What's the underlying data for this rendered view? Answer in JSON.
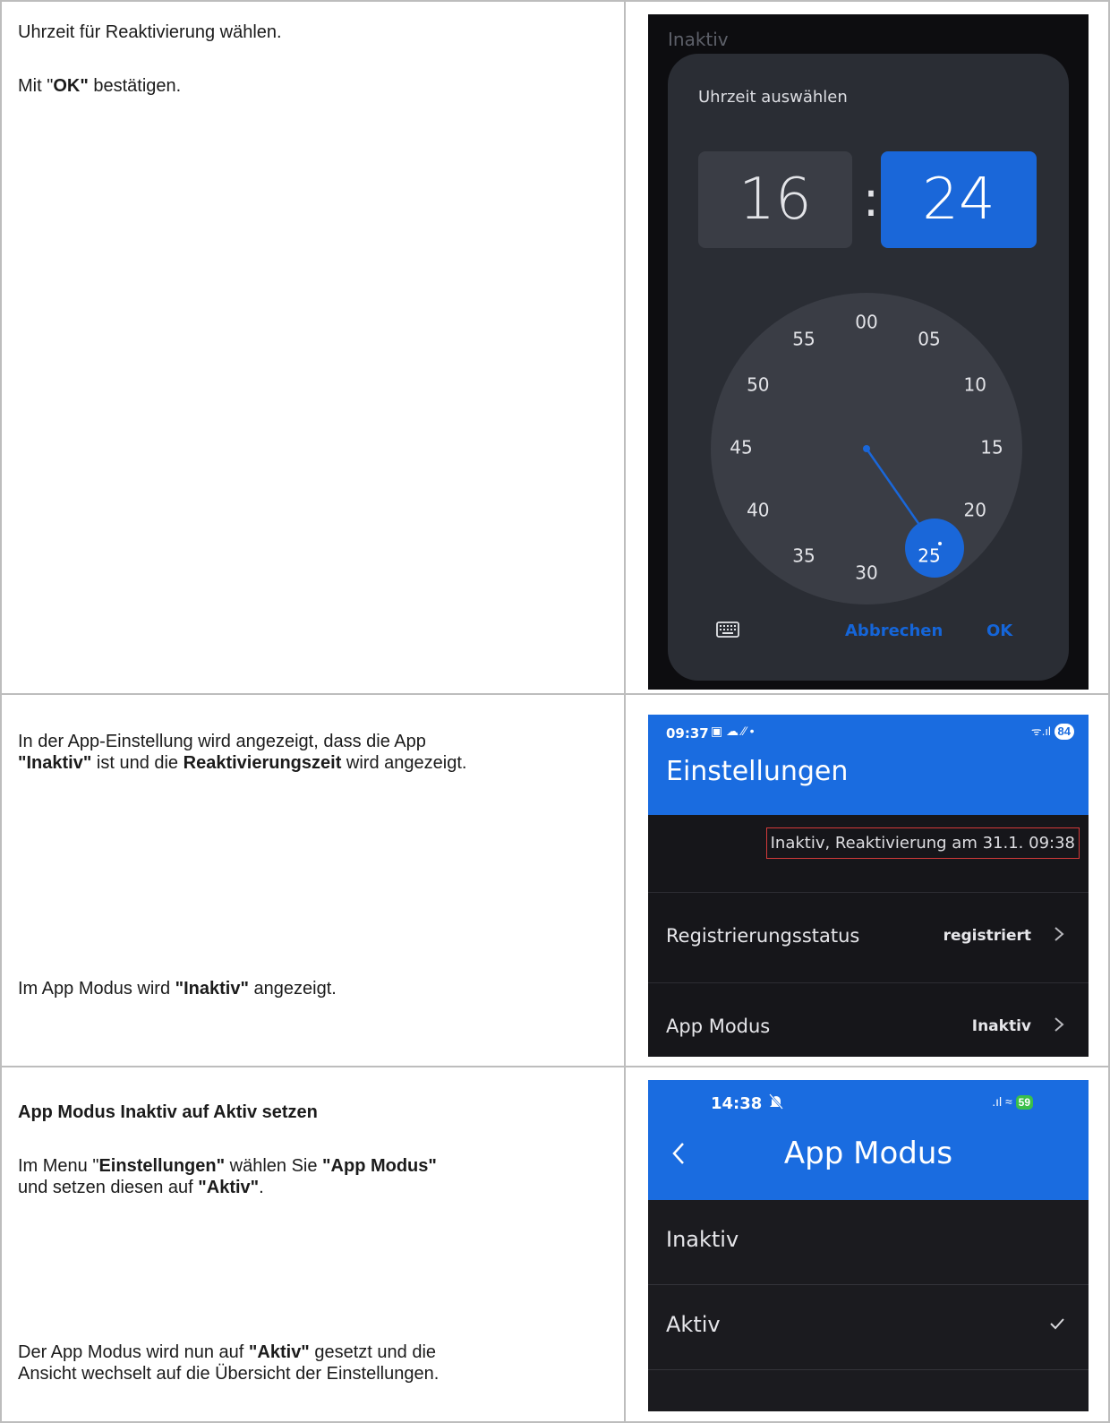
{
  "rows": [
    {
      "left": {
        "line1": "Uhrzeit für Reaktivierung wählen.",
        "line2_pre": "Mit \"",
        "line2_bold": "OK\"",
        "line2_post": " bestätigen."
      },
      "screenshot": {
        "background_title": "Inaktiv",
        "dialog_title": "Uhrzeit auswählen",
        "hour": "16",
        "separator": ":",
        "minute": "24",
        "clock_labels": [
          "00",
          "05",
          "10",
          "15",
          "20",
          "25",
          "30",
          "35",
          "40",
          "45",
          "50",
          "55"
        ],
        "selected_minute_label": "25",
        "keyboard_icon": "keyboard-icon",
        "cancel_label": "Abbrechen",
        "ok_label": "OK"
      }
    },
    {
      "left": {
        "p1_a": "In der App-Einstellung wird angezeigt, dass die App",
        "p1_b_bold": "\"Inaktiv\"",
        "p1_b_mid": " ist und die ",
        "p1_b_bold2": "Reaktivierungszeit",
        "p1_b_post": " wird angezeigt.",
        "p2_pre": "Im App Modus wird ",
        "p2_bold": "\"Inaktiv\"",
        "p2_post": " angezeigt."
      },
      "screenshot": {
        "status_time": "09:37",
        "status_icons": "▣ ☁ ⁄⁄ •",
        "signal_text": "ᯤ.ıl",
        "battery": "84",
        "title": "Einstellungen",
        "status_message": "Inaktiv, Reaktivierung am 31.1. 09:38",
        "items": [
          {
            "label": "Registrierungsstatus",
            "value": "registriert"
          },
          {
            "label": "App Modus",
            "value": "Inaktiv"
          }
        ]
      }
    },
    {
      "left": {
        "heading": "App Modus Inaktiv auf Aktiv setzen",
        "p1_pre": "Im Menu \"",
        "p1_bold1": "Einstellungen\"",
        "p1_mid": " wählen Sie ",
        "p1_bold2": "\"App Modus\"",
        "p1_line2_pre": "und setzen diesen auf ",
        "p1_line2_bold": "\"Aktiv\"",
        "p1_line2_post": ".",
        "p2_pre": "Der App Modus wird nun auf ",
        "p2_bold": "\"Aktiv\"",
        "p2_post": " gesetzt und die",
        "p2_line2": "Ansicht wechselt auf die Übersicht der Einstellungen."
      },
      "screenshot": {
        "status_time": "14:38",
        "signal_text": ".ıl ≈",
        "battery": "59",
        "title": "App Modus",
        "options": [
          {
            "label": "Inaktiv",
            "selected": false
          },
          {
            "label": "Aktiv",
            "selected": true
          }
        ]
      }
    }
  ]
}
